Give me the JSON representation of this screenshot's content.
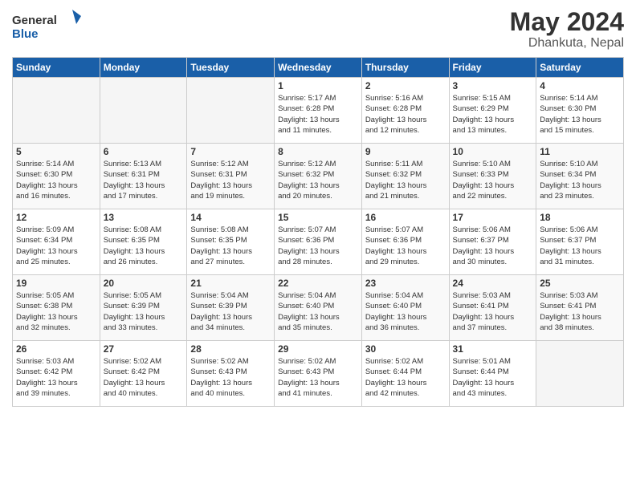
{
  "header": {
    "logo_general": "General",
    "logo_blue": "Blue",
    "month": "May 2024",
    "location": "Dhankuta, Nepal"
  },
  "weekdays": [
    "Sunday",
    "Monday",
    "Tuesday",
    "Wednesday",
    "Thursday",
    "Friday",
    "Saturday"
  ],
  "weeks": [
    [
      {
        "day": "",
        "info": ""
      },
      {
        "day": "",
        "info": ""
      },
      {
        "day": "",
        "info": ""
      },
      {
        "day": "1",
        "info": "Sunrise: 5:17 AM\nSunset: 6:28 PM\nDaylight: 13 hours\nand 11 minutes."
      },
      {
        "day": "2",
        "info": "Sunrise: 5:16 AM\nSunset: 6:28 PM\nDaylight: 13 hours\nand 12 minutes."
      },
      {
        "day": "3",
        "info": "Sunrise: 5:15 AM\nSunset: 6:29 PM\nDaylight: 13 hours\nand 13 minutes."
      },
      {
        "day": "4",
        "info": "Sunrise: 5:14 AM\nSunset: 6:30 PM\nDaylight: 13 hours\nand 15 minutes."
      }
    ],
    [
      {
        "day": "5",
        "info": "Sunrise: 5:14 AM\nSunset: 6:30 PM\nDaylight: 13 hours\nand 16 minutes."
      },
      {
        "day": "6",
        "info": "Sunrise: 5:13 AM\nSunset: 6:31 PM\nDaylight: 13 hours\nand 17 minutes."
      },
      {
        "day": "7",
        "info": "Sunrise: 5:12 AM\nSunset: 6:31 PM\nDaylight: 13 hours\nand 19 minutes."
      },
      {
        "day": "8",
        "info": "Sunrise: 5:12 AM\nSunset: 6:32 PM\nDaylight: 13 hours\nand 20 minutes."
      },
      {
        "day": "9",
        "info": "Sunrise: 5:11 AM\nSunset: 6:32 PM\nDaylight: 13 hours\nand 21 minutes."
      },
      {
        "day": "10",
        "info": "Sunrise: 5:10 AM\nSunset: 6:33 PM\nDaylight: 13 hours\nand 22 minutes."
      },
      {
        "day": "11",
        "info": "Sunrise: 5:10 AM\nSunset: 6:34 PM\nDaylight: 13 hours\nand 23 minutes."
      }
    ],
    [
      {
        "day": "12",
        "info": "Sunrise: 5:09 AM\nSunset: 6:34 PM\nDaylight: 13 hours\nand 25 minutes."
      },
      {
        "day": "13",
        "info": "Sunrise: 5:08 AM\nSunset: 6:35 PM\nDaylight: 13 hours\nand 26 minutes."
      },
      {
        "day": "14",
        "info": "Sunrise: 5:08 AM\nSunset: 6:35 PM\nDaylight: 13 hours\nand 27 minutes."
      },
      {
        "day": "15",
        "info": "Sunrise: 5:07 AM\nSunset: 6:36 PM\nDaylight: 13 hours\nand 28 minutes."
      },
      {
        "day": "16",
        "info": "Sunrise: 5:07 AM\nSunset: 6:36 PM\nDaylight: 13 hours\nand 29 minutes."
      },
      {
        "day": "17",
        "info": "Sunrise: 5:06 AM\nSunset: 6:37 PM\nDaylight: 13 hours\nand 30 minutes."
      },
      {
        "day": "18",
        "info": "Sunrise: 5:06 AM\nSunset: 6:37 PM\nDaylight: 13 hours\nand 31 minutes."
      }
    ],
    [
      {
        "day": "19",
        "info": "Sunrise: 5:05 AM\nSunset: 6:38 PM\nDaylight: 13 hours\nand 32 minutes."
      },
      {
        "day": "20",
        "info": "Sunrise: 5:05 AM\nSunset: 6:39 PM\nDaylight: 13 hours\nand 33 minutes."
      },
      {
        "day": "21",
        "info": "Sunrise: 5:04 AM\nSunset: 6:39 PM\nDaylight: 13 hours\nand 34 minutes."
      },
      {
        "day": "22",
        "info": "Sunrise: 5:04 AM\nSunset: 6:40 PM\nDaylight: 13 hours\nand 35 minutes."
      },
      {
        "day": "23",
        "info": "Sunrise: 5:04 AM\nSunset: 6:40 PM\nDaylight: 13 hours\nand 36 minutes."
      },
      {
        "day": "24",
        "info": "Sunrise: 5:03 AM\nSunset: 6:41 PM\nDaylight: 13 hours\nand 37 minutes."
      },
      {
        "day": "25",
        "info": "Sunrise: 5:03 AM\nSunset: 6:41 PM\nDaylight: 13 hours\nand 38 minutes."
      }
    ],
    [
      {
        "day": "26",
        "info": "Sunrise: 5:03 AM\nSunset: 6:42 PM\nDaylight: 13 hours\nand 39 minutes."
      },
      {
        "day": "27",
        "info": "Sunrise: 5:02 AM\nSunset: 6:42 PM\nDaylight: 13 hours\nand 40 minutes."
      },
      {
        "day": "28",
        "info": "Sunrise: 5:02 AM\nSunset: 6:43 PM\nDaylight: 13 hours\nand 40 minutes."
      },
      {
        "day": "29",
        "info": "Sunrise: 5:02 AM\nSunset: 6:43 PM\nDaylight: 13 hours\nand 41 minutes."
      },
      {
        "day": "30",
        "info": "Sunrise: 5:02 AM\nSunset: 6:44 PM\nDaylight: 13 hours\nand 42 minutes."
      },
      {
        "day": "31",
        "info": "Sunrise: 5:01 AM\nSunset: 6:44 PM\nDaylight: 13 hours\nand 43 minutes."
      },
      {
        "day": "",
        "info": ""
      }
    ]
  ]
}
